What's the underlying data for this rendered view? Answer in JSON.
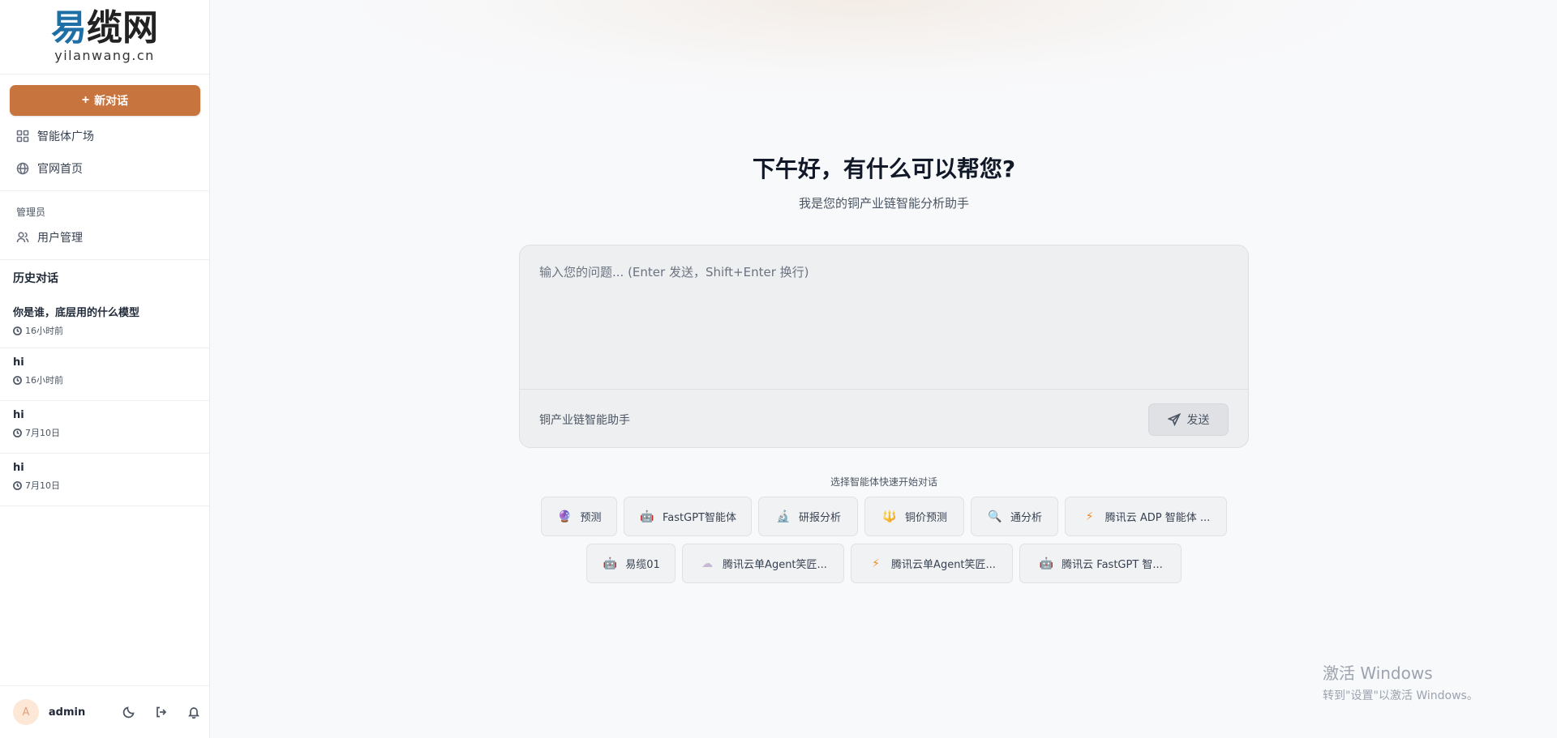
{
  "logo": {
    "mark_part1": "易",
    "mark_part2": "缆网",
    "domain": "yilanwang.cn"
  },
  "sidebar": {
    "new_chat_label": "新对话",
    "nav": [
      {
        "label": "智能体广场",
        "icon": "grid-icon"
      },
      {
        "label": "官网首页",
        "icon": "globe-icon"
      }
    ],
    "admin_section_label": "管理员",
    "admin_nav": [
      {
        "label": "用户管理",
        "icon": "users-icon"
      }
    ],
    "history_title": "历史对话",
    "history": [
      {
        "title": "你是谁，底层用的什么模型",
        "time": "16小时前"
      },
      {
        "title": "hi",
        "time": "16小时前"
      },
      {
        "title": "hi",
        "time": "7月10日"
      },
      {
        "title": "hi",
        "time": "7月10日"
      }
    ],
    "user": {
      "avatar_letter": "A",
      "name": "admin"
    }
  },
  "main": {
    "greeting": "下午好，有什么可以帮您?",
    "subtitle": "我是您的铜产业链智能分析助手",
    "input_placeholder": "输入您的问题... (Enter 发送，Shift+Enter 换行)",
    "current_agent": "铜产业链智能助手",
    "send_label": "发送",
    "quick_label": "选择智能体快速开始对话",
    "agents_row1": [
      {
        "label": "预测",
        "icon": "crystal-ball-icon",
        "glyph": "🔮"
      },
      {
        "label": "FastGPT智能体",
        "icon": "robot-icon",
        "glyph": "🤖"
      },
      {
        "label": "研报分析",
        "icon": "microscope-icon",
        "glyph": "🔬"
      },
      {
        "label": "铜价预测",
        "icon": "trident-icon",
        "glyph": "🔱"
      },
      {
        "label": "通分析",
        "icon": "magnifier-icon",
        "glyph": "🔍"
      },
      {
        "label": "腾讯云 ADP 智能体 ...",
        "icon": "lightning-icon",
        "glyph": "⚡"
      }
    ],
    "agents_row2": [
      {
        "label": "易缆01",
        "icon": "robot-icon",
        "glyph": "🤖"
      },
      {
        "label": "腾讯云单Agent笑匠...",
        "icon": "cloud-icon",
        "glyph": "☁"
      },
      {
        "label": "腾讯云单Agent笑匠...",
        "icon": "lightning-icon",
        "glyph": "⚡"
      },
      {
        "label": "腾讯云 FastGPT 智...",
        "icon": "robot-icon",
        "glyph": "🤖"
      }
    ]
  },
  "watermark": {
    "line1": "激活 Windows",
    "line2": "转到\"设置\"以激活 Windows。"
  }
}
